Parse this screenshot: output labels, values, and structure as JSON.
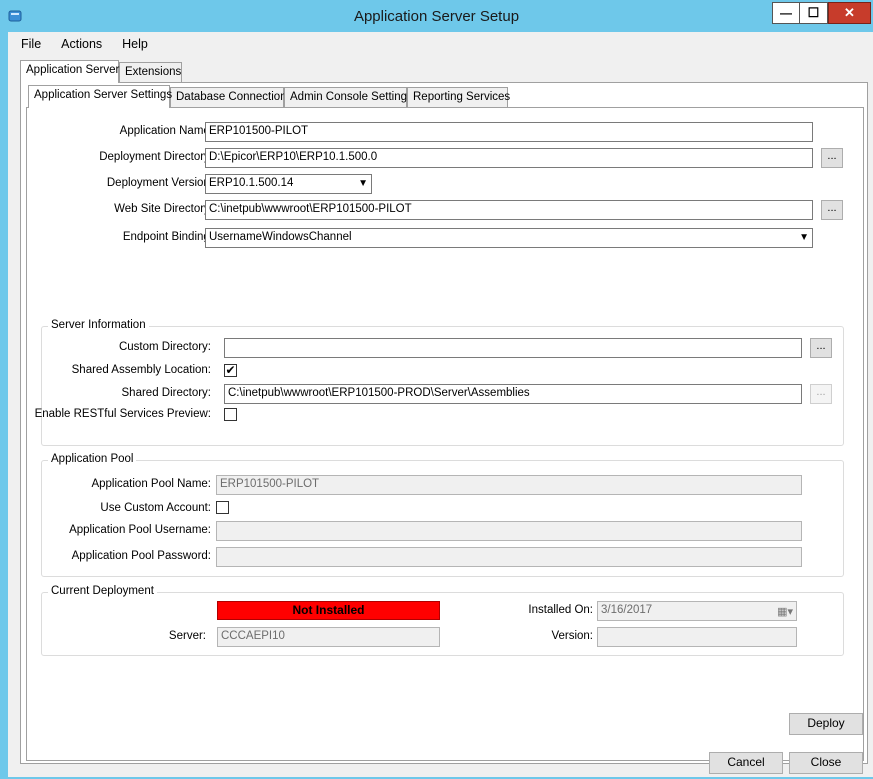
{
  "window": {
    "title": "Application Server Setup",
    "minimize_glyph": "—",
    "maximize_glyph": "☐",
    "close_glyph": "✕"
  },
  "menu": [
    "File",
    "Actions",
    "Help"
  ],
  "outer_tabs": [
    "Application Server",
    "Extensions"
  ],
  "inner_tabs": [
    "Application Server Settings",
    "Database Connection",
    "Admin Console Settings",
    "Reporting Services"
  ],
  "settings": {
    "app_name_label": "Application Name:",
    "app_name": "ERP101500-PILOT",
    "deploy_dir_label": "Deployment Directory:",
    "deploy_dir": "D:\\Epicor\\ERP10\\ERP10.1.500.0",
    "deploy_version_label": "Deployment Version:",
    "deploy_version": "ERP10.1.500.14",
    "web_dir_label": "Web Site Directory:",
    "web_dir": "C:\\inetpub\\wwwroot\\ERP101500-PILOT",
    "endpoint_label": "Endpoint Binding:",
    "endpoint": "UsernameWindowsChannel",
    "browse_label": "..."
  },
  "server_info": {
    "title": "Server Information",
    "custom_dir_label": "Custom Directory:",
    "custom_dir": "",
    "shared_assembly_label": "Shared Assembly Location:",
    "shared_assembly_checked": "✔",
    "shared_dir_label": "Shared Directory:",
    "shared_dir": "C:\\inetpub\\wwwroot\\ERP101500-PROD\\Server\\Assemblies",
    "restful_label": "Enable RESTful Services Preview:"
  },
  "app_pool": {
    "title": "Application Pool",
    "name_label": "Application Pool Name:",
    "name": "ERP101500-PILOT",
    "custom_account_label": "Use Custom Account:",
    "username_label": "Application Pool Username:",
    "password_label": "Application Pool Password:"
  },
  "current_deployment": {
    "title": "Current Deployment",
    "status": "Not Installed",
    "status_color": "#ff0000",
    "server_label": "Server:",
    "server": "CCCAEPI10",
    "installed_on_label": "Installed On:",
    "installed_on": "3/16/2017",
    "version_label": "Version:",
    "version": ""
  },
  "buttons": {
    "deploy": "Deploy",
    "cancel": "Cancel",
    "close": "Close"
  }
}
